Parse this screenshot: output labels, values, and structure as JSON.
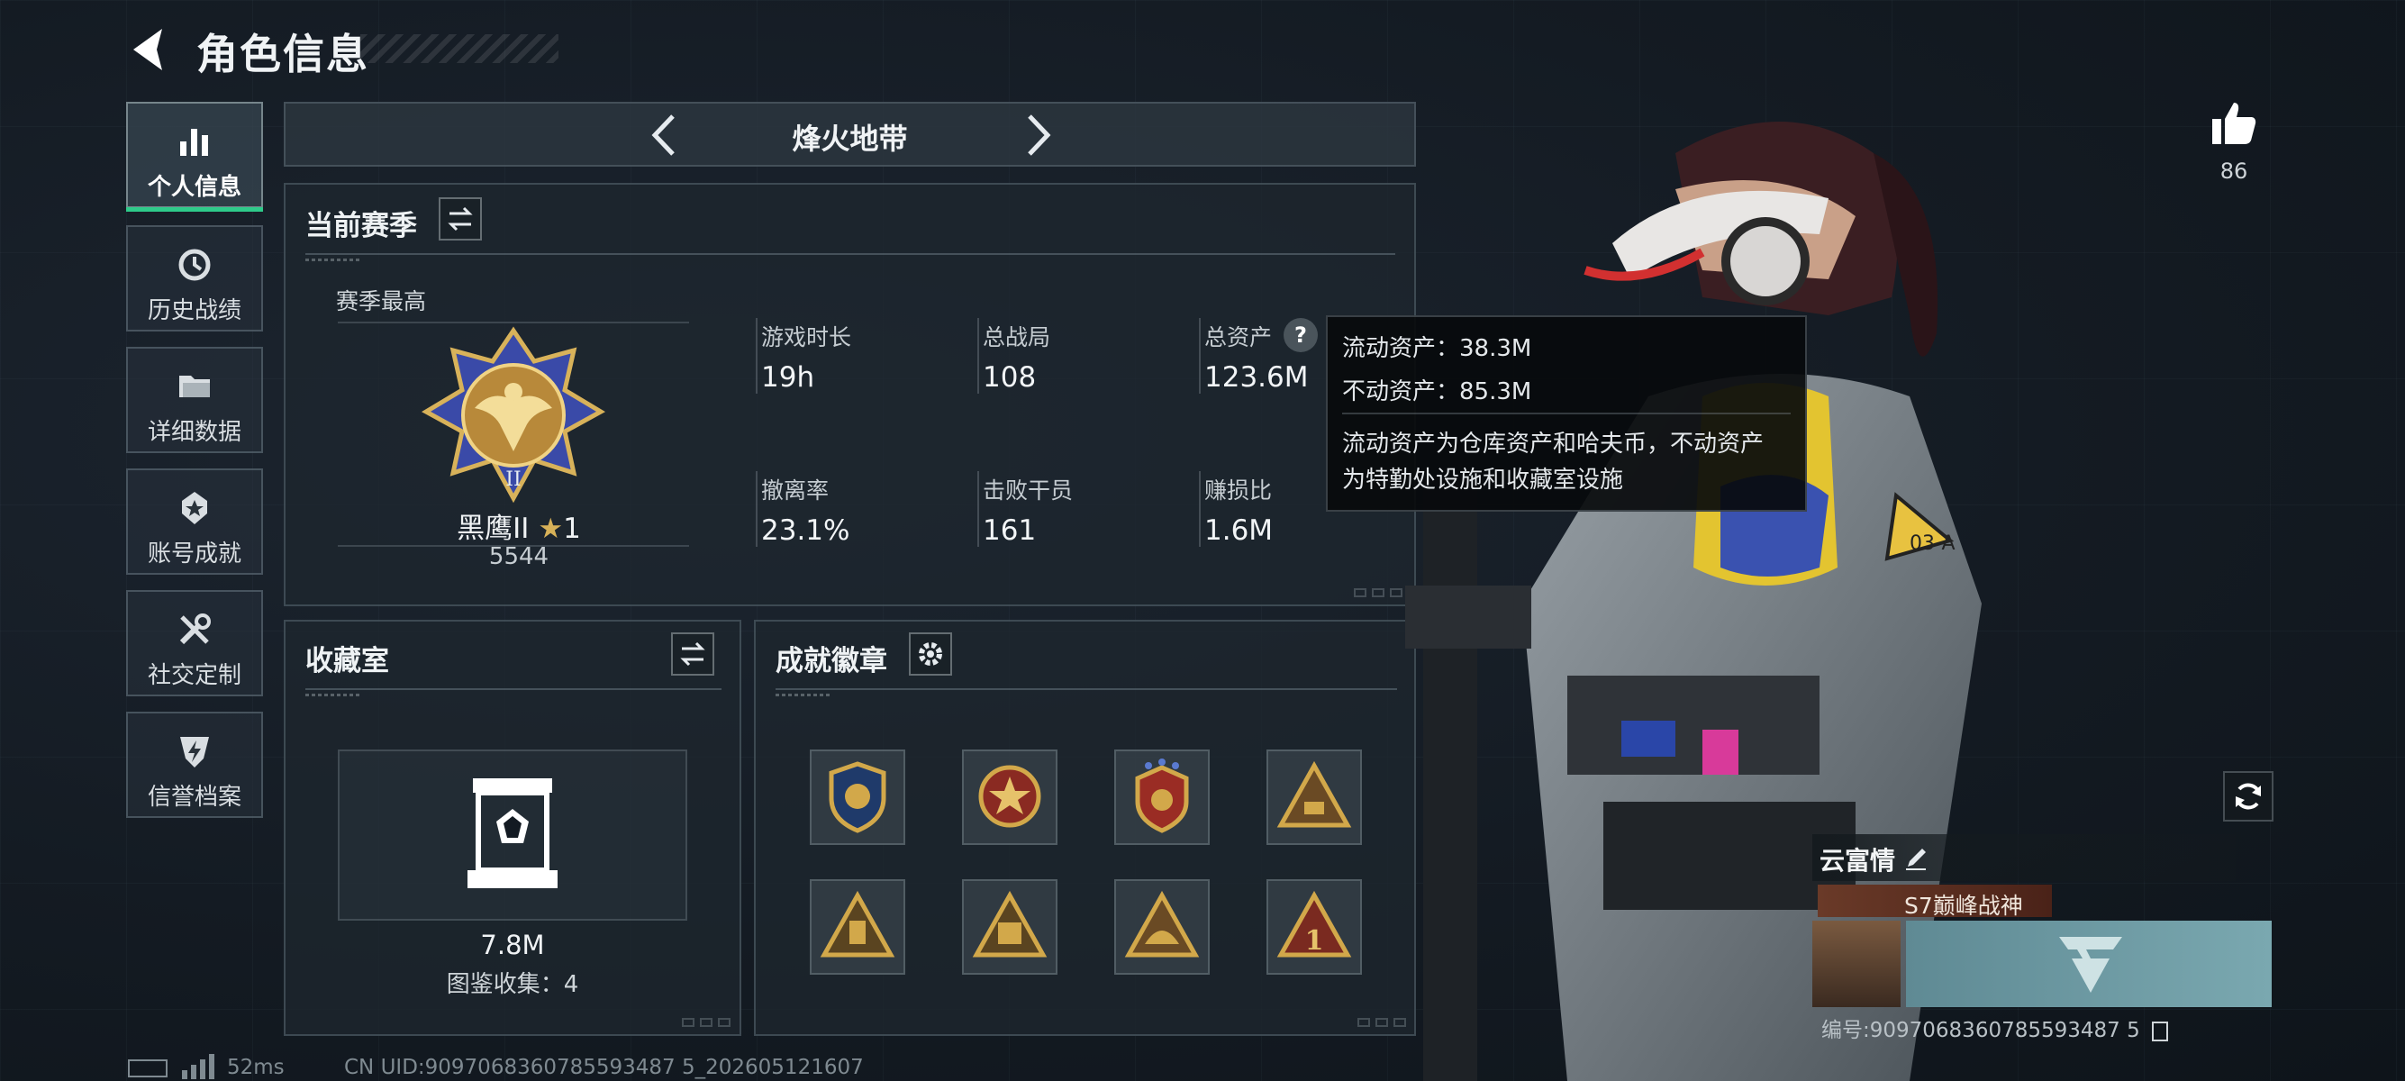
{
  "header": {
    "title": "角色信息",
    "back_icon": "back-arrow-icon"
  },
  "sidebar": {
    "items": [
      {
        "label": "个人信息",
        "icon": "bar-chart-icon",
        "active": true
      },
      {
        "label": "历史战绩",
        "icon": "history-clock-icon",
        "active": false
      },
      {
        "label": "详细数据",
        "icon": "folder-icon",
        "active": false
      },
      {
        "label": "账号成就",
        "icon": "achievement-icon",
        "active": false
      },
      {
        "label": "社交定制",
        "icon": "tools-icon",
        "active": false
      },
      {
        "label": "信誉档案",
        "icon": "shield-bolt-icon",
        "active": false
      }
    ]
  },
  "mode_tab": {
    "label": "烽火地带"
  },
  "season": {
    "title": "当前赛季",
    "best_label": "赛季最高",
    "rank_name": "黑鹰II",
    "rank_stars": "1",
    "rank_points": "5544",
    "stats": [
      {
        "label": "游戏时长",
        "value": "19h"
      },
      {
        "label": "总战局",
        "value": "108"
      },
      {
        "label": "总资产",
        "value": "123.6M"
      },
      {
        "label": "撤离率",
        "value": "23.1%"
      },
      {
        "label": "击败干员",
        "value": "161"
      },
      {
        "label": "赚损比",
        "value": "1.6M"
      }
    ]
  },
  "tooltip": {
    "line1": "流动资产：38.3M",
    "line2": "不动资产：85.3M",
    "desc1": "流动资产为仓库资产和哈夫币，不动资产",
    "desc2": "为特勤处设施和收藏室设施"
  },
  "collection": {
    "title": "收藏室",
    "value": "7.8M",
    "count_label": "图鉴收集：4"
  },
  "badges": {
    "title": "成就徽章",
    "items": [
      "badge-1",
      "badge-2",
      "badge-3",
      "badge-4",
      "badge-5",
      "badge-6",
      "badge-7",
      "badge-8"
    ]
  },
  "like": {
    "count": "86"
  },
  "name_card": {
    "name": "云富情",
    "title": "S7巅峰战神",
    "uid": "编号:9097068360785593487 5"
  },
  "status_bar": {
    "ping": "52ms",
    "uid": "CN UID:9097068360785593487 5_202605121607"
  },
  "colors": {
    "accent": "#2ecb8a",
    "gold": "#c9a04a",
    "bg": "#131a22"
  }
}
